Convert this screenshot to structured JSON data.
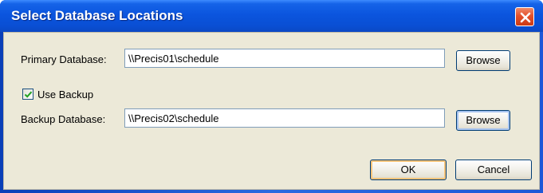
{
  "window": {
    "title": "Select Database Locations",
    "icons": {
      "close": "close-icon",
      "check": "check-icon"
    }
  },
  "primary": {
    "label": "Primary Database:",
    "value": "\\\\Precis01\\schedule",
    "browse_label": "Browse"
  },
  "use_backup": {
    "label": "Use Backup",
    "checked": true
  },
  "backup": {
    "label": "Backup Database:",
    "value": "\\\\Precis02\\schedule",
    "browse_label": "Browse"
  },
  "footer": {
    "ok_label": "OK",
    "cancel_label": "Cancel"
  }
}
